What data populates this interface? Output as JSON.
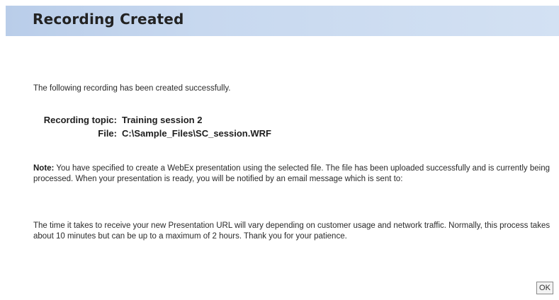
{
  "dialog": {
    "title": "Recording Created",
    "intro": "The following recording has been created successfully.",
    "details": {
      "topic_label": "Recording topic:",
      "topic_value": "Training session 2",
      "file_label": "File:",
      "file_value": "C:\\Sample_Files\\SC_session.WRF"
    },
    "note_label": "Note:",
    "note_text": " You have specified to create a WebEx presentation using the selected file. The file has been uploaded successfully and is currently being processed. When your presentation is ready, you will be notified by an email message which is sent to:",
    "time_text": "The time it takes to receive your new Presentation URL will vary depending on customer usage and network traffic. Normally, this process takes about 10 minutes but can be up to a maximum of 2 hours. Thank you for your patience.",
    "ok_label": "OK"
  },
  "colors": {
    "title_bar": "#c7d8ef",
    "title_text": "#222222"
  }
}
